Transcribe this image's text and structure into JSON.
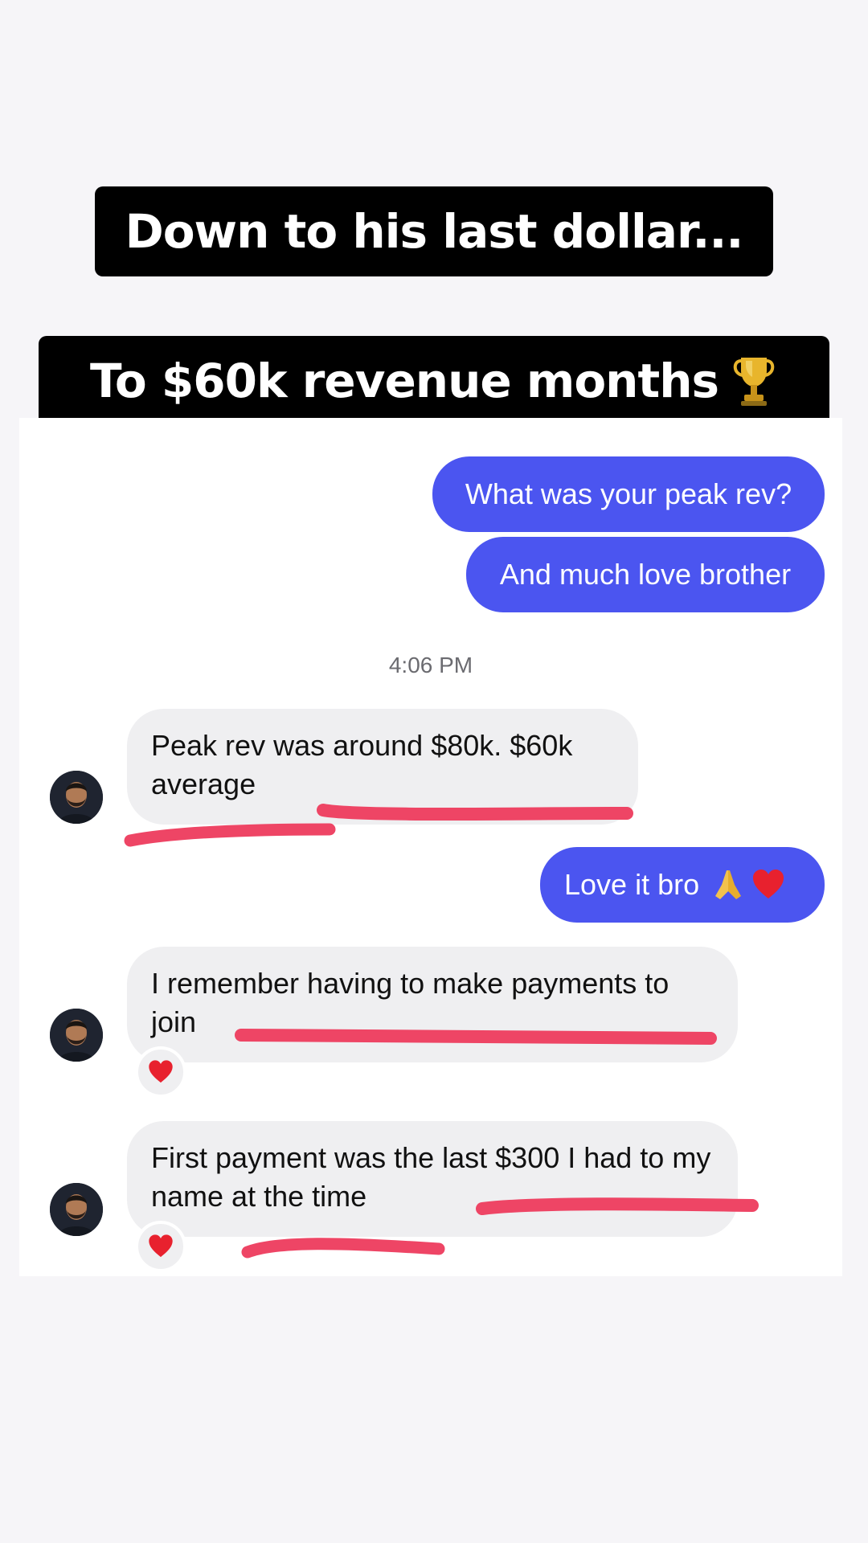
{
  "headlines": {
    "line1": "Down to his last dollar...",
    "line2": "To $60k revenue months"
  },
  "icons": {
    "trophy": "trophy-icon",
    "reaction": "heart-icon",
    "pray": "folded-hands-icon"
  },
  "colors": {
    "outgoing_bubble": "#4b55f0",
    "incoming_bubble": "#efeff1",
    "highlight": "#ee4565",
    "headline_bg": "#000000"
  },
  "chat": {
    "messages": [
      {
        "direction": "outgoing",
        "text": "What was your peak rev?"
      },
      {
        "direction": "outgoing",
        "text": "And much love brother"
      },
      {
        "type": "timestamp",
        "text": "4:06 PM"
      },
      {
        "direction": "incoming",
        "text": "Peak rev was around $80k. $60k average"
      },
      {
        "direction": "outgoing",
        "text": "Love it bro"
      },
      {
        "direction": "incoming",
        "text": "I remember having to make payments to join",
        "reaction": "heart"
      },
      {
        "direction": "incoming",
        "text": "First payment was the last $300 I had to my name at the time",
        "reaction": "heart"
      }
    ]
  }
}
